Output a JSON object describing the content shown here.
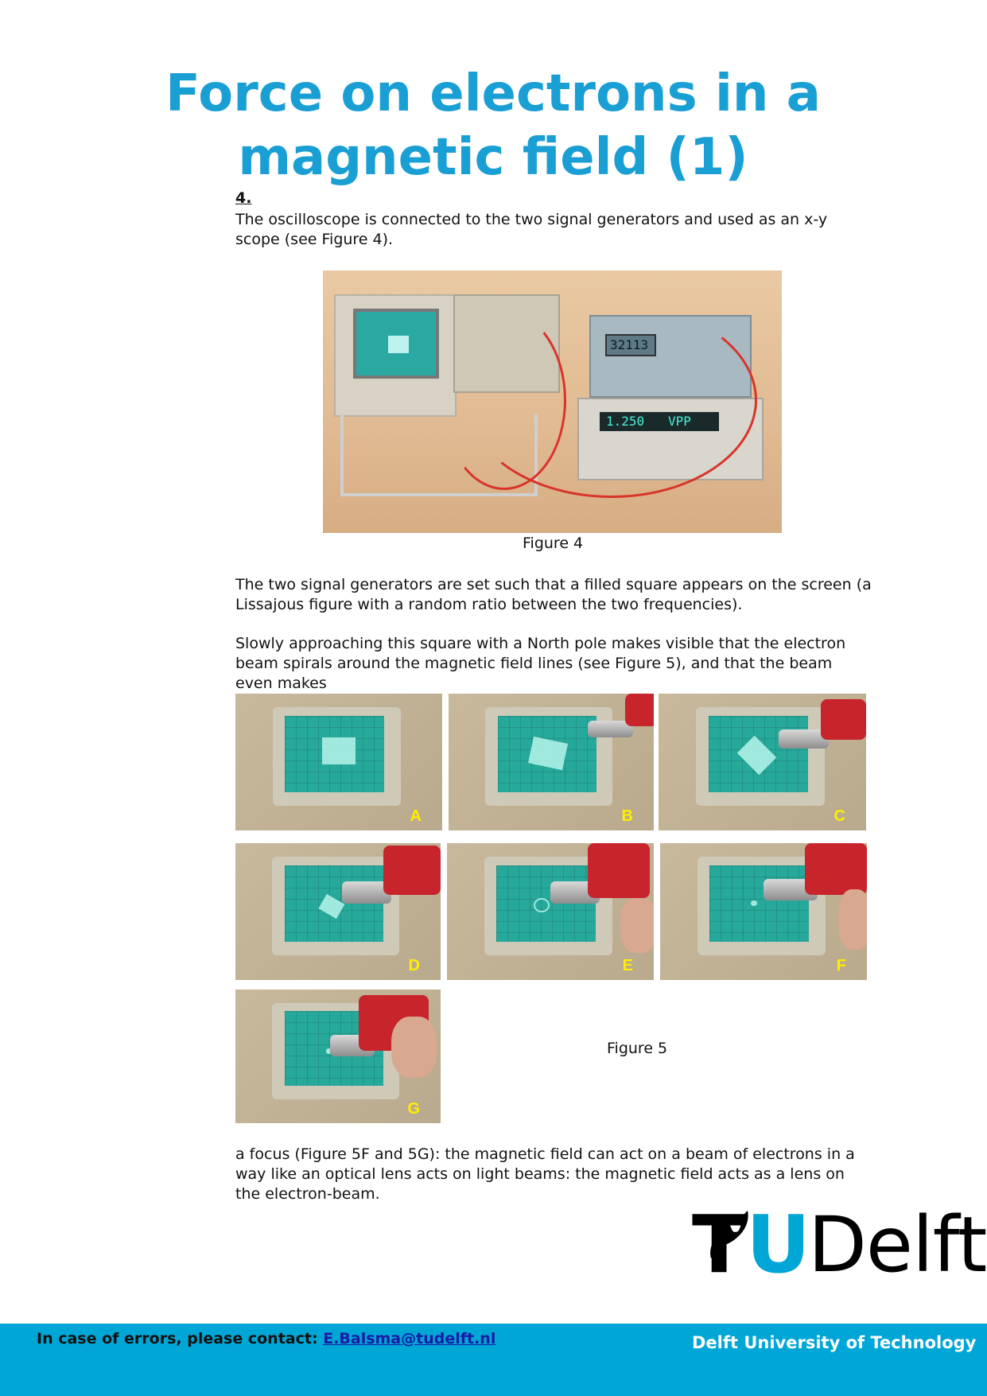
{
  "title": {
    "line1": "Force on electrons in a",
    "line2": "magnetic field (1)"
  },
  "step_number": "4.",
  "paragraphs": {
    "p1": "The oscilloscope is connected to the two signal generators and used as an x-y scope (see Figure 4).",
    "p2": "The two signal generators are set such that a filled square appears on the screen (a Lissajous figure with a random ratio between the two frequencies).",
    "p3": "Slowly approaching this square with a North pole makes visible that the electron beam spirals around the magnetic field lines (see Figure 5), and that the beam even makes",
    "p4": "a focus (Figure 5F and 5G): the magnetic field can act on a beam of electrons in a way like an optical lens acts on light beams: the magnetic field acts as a lens on the electron-beam."
  },
  "figure4": {
    "caption": "Figure 4",
    "gen1_display": "32113",
    "gen2_display": "1.250",
    "gen2_unit": "VPP"
  },
  "figure5": {
    "caption": "Figure 5",
    "tiles": [
      "A",
      "B",
      "C",
      "D",
      "E",
      "F",
      "G"
    ]
  },
  "footer": {
    "contact_label": "In case of errors, please contact:",
    "contact_email": "E.Balsma@tudelft.nl",
    "university": "Delft University of Technology"
  },
  "logo": {
    "t": "T",
    "u": "U",
    "delft": "Delft"
  },
  "colors": {
    "title": "#1a9fd4",
    "footer_bar": "#00a6d6",
    "tile_label": "#ffee00"
  }
}
